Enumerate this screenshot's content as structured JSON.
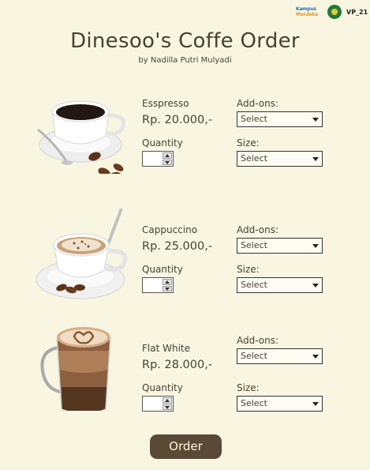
{
  "logos": {
    "kampus_merdeka_line1": "Kampus",
    "kampus_merdeka_line2": "Merdeka",
    "vp_text": "VP_21"
  },
  "header": {
    "title": "Dinesoo's Coffe Order",
    "subtitle": "by Nadilla Putri Mulyadi"
  },
  "labels": {
    "addons": "Add-ons:",
    "quantity": "Quantity",
    "size": "Size:"
  },
  "products": [
    {
      "name": "Esspresso",
      "price": "Rp. 20.000,-",
      "image": "espresso-cup-icon",
      "addons_value": "Select",
      "size_value": "Select",
      "quantity_value": ""
    },
    {
      "name": "Cappuccino",
      "price": "Rp. 25.000,-",
      "image": "cappuccino-cup-icon",
      "addons_value": "Select",
      "size_value": "Select",
      "quantity_value": ""
    },
    {
      "name": "Flat White",
      "price": "Rp. 28.000,-",
      "image": "flat-white-glass-icon",
      "addons_value": "Select",
      "size_value": "Select",
      "quantity_value": ""
    }
  ],
  "order_button": "Order",
  "colors": {
    "background": "#f8f6e1",
    "button": "#5a4a35",
    "text": "#4a3f33"
  }
}
